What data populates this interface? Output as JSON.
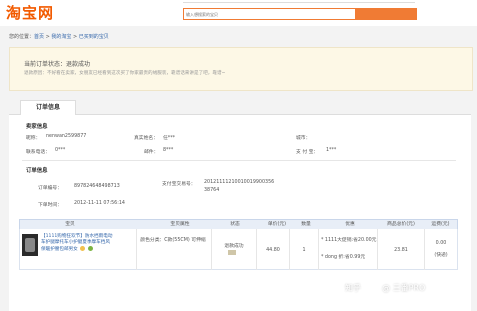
{
  "header": {
    "logo": "淘宝网",
    "search_placeholder": "输入想搜索的宝贝"
  },
  "breadcrumb": {
    "prefix": "您的位置：",
    "items": [
      "首页",
      "我的淘宝",
      "已买到的宝贝"
    ],
    "separator": " > "
  },
  "status": {
    "title": "当前订单状态：退款成功",
    "desc": "退款原因：不好看在卖家，女朋友已经看到这次买了你家最贵的绒服装，靠谱话来讲是了吧，靠谱~"
  },
  "tab": {
    "label": "订单信息"
  },
  "seller": {
    "section": "卖家信息",
    "nick_label": "昵称：",
    "nick_value": "nenwan2599877",
    "realname_label": "真实姓名：",
    "realname_value": "任***",
    "city_label": "城市：",
    "city_value": "",
    "phone_label": "联系电话：",
    "phone_value": "0***",
    "email_label": "邮件：",
    "email_value": "8***",
    "alipay_label": "支 付 宝：",
    "alipay_value": "1***"
  },
  "order": {
    "section": "订单信息",
    "no_label": "订单编号：",
    "no_value": "897824648498713",
    "pay_label": "支付宝交易号：",
    "pay_value_1": "20121111210010019900356",
    "pay_value_2": "38764",
    "time_label": "下单时间：",
    "time_value": "2012-11-11 07:56:14"
  },
  "table": {
    "headers": [
      "宝贝",
      "宝贝属性",
      "状态",
      "单价(元)",
      "数量",
      "优惠",
      "商品总价(元)",
      "运费(元)"
    ],
    "row": {
      "product": "【1111购物狂欢节】防水挡雨电动车护腿摩托车小护腿夏季摩车挡风保暖护腰包邮男女",
      "attr": "颜色分类：C款(55CM)  可伸缩",
      "status": "退款成功",
      "price": "44.80",
      "qty": "1",
      "discount_1": "* 1111大促销:省20.00元",
      "discount_2": "* dong 折:省0.99元",
      "total": "23.81",
      "shipping": "0.00",
      "shipping_mode": "(快递)"
    }
  },
  "watermark": {
    "site": "知乎",
    "author": "@ 三番PRO"
  },
  "colors": {
    "accent": "#f07b34",
    "link": "#3366aa",
    "status_bg": "#fdf8e6"
  }
}
